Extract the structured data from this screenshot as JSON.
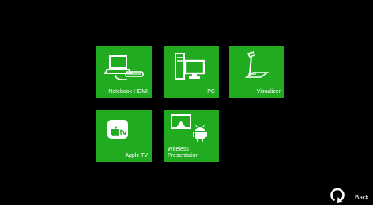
{
  "colors": {
    "background": "#000000",
    "tile": "#20ab20",
    "text": "#ffffff"
  },
  "tiles": [
    {
      "label": "Notebook HDMI",
      "icon": "laptop-hdmi-icon"
    },
    {
      "label": "PC",
      "icon": "pc-monitor-icon"
    },
    {
      "label": "Visualizer",
      "icon": "document-camera-icon"
    },
    {
      "label": "Apple TV",
      "icon": "apple-tv-icon"
    },
    {
      "label": "Wireless Presentation",
      "icon": "airplay-android-icon"
    }
  ],
  "apple_tv_logo_text": "tv",
  "back": {
    "label": "Back",
    "icon": "back-arrow-icon"
  }
}
